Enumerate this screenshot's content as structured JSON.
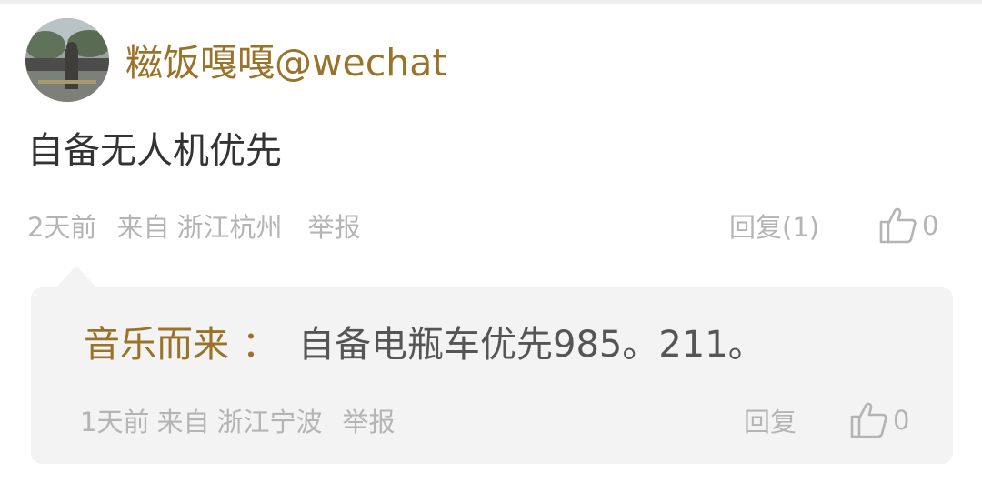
{
  "comment": {
    "username": "糍饭嘎嘎@wechat",
    "text": "自备无人机优先",
    "time": "2天前",
    "from_label": "来自",
    "location": "浙江杭州",
    "report_label": "举报",
    "reply_label": "回复(1)",
    "like_count": "0"
  },
  "reply": {
    "author": "音乐而来",
    "colon": "：",
    "text": "自备电瓶车优先985。211。",
    "time": "1天前",
    "from_label": "来自",
    "location": "浙江宁波",
    "report_label": "举报",
    "reply_label": "回复",
    "like_count": "0"
  },
  "icons": {
    "like": "thumbs-up-icon"
  },
  "colors": {
    "username": "#9a7228",
    "meta": "#b4b4b4",
    "reply_bg": "#f3f3f3",
    "body_text": "#333333"
  }
}
